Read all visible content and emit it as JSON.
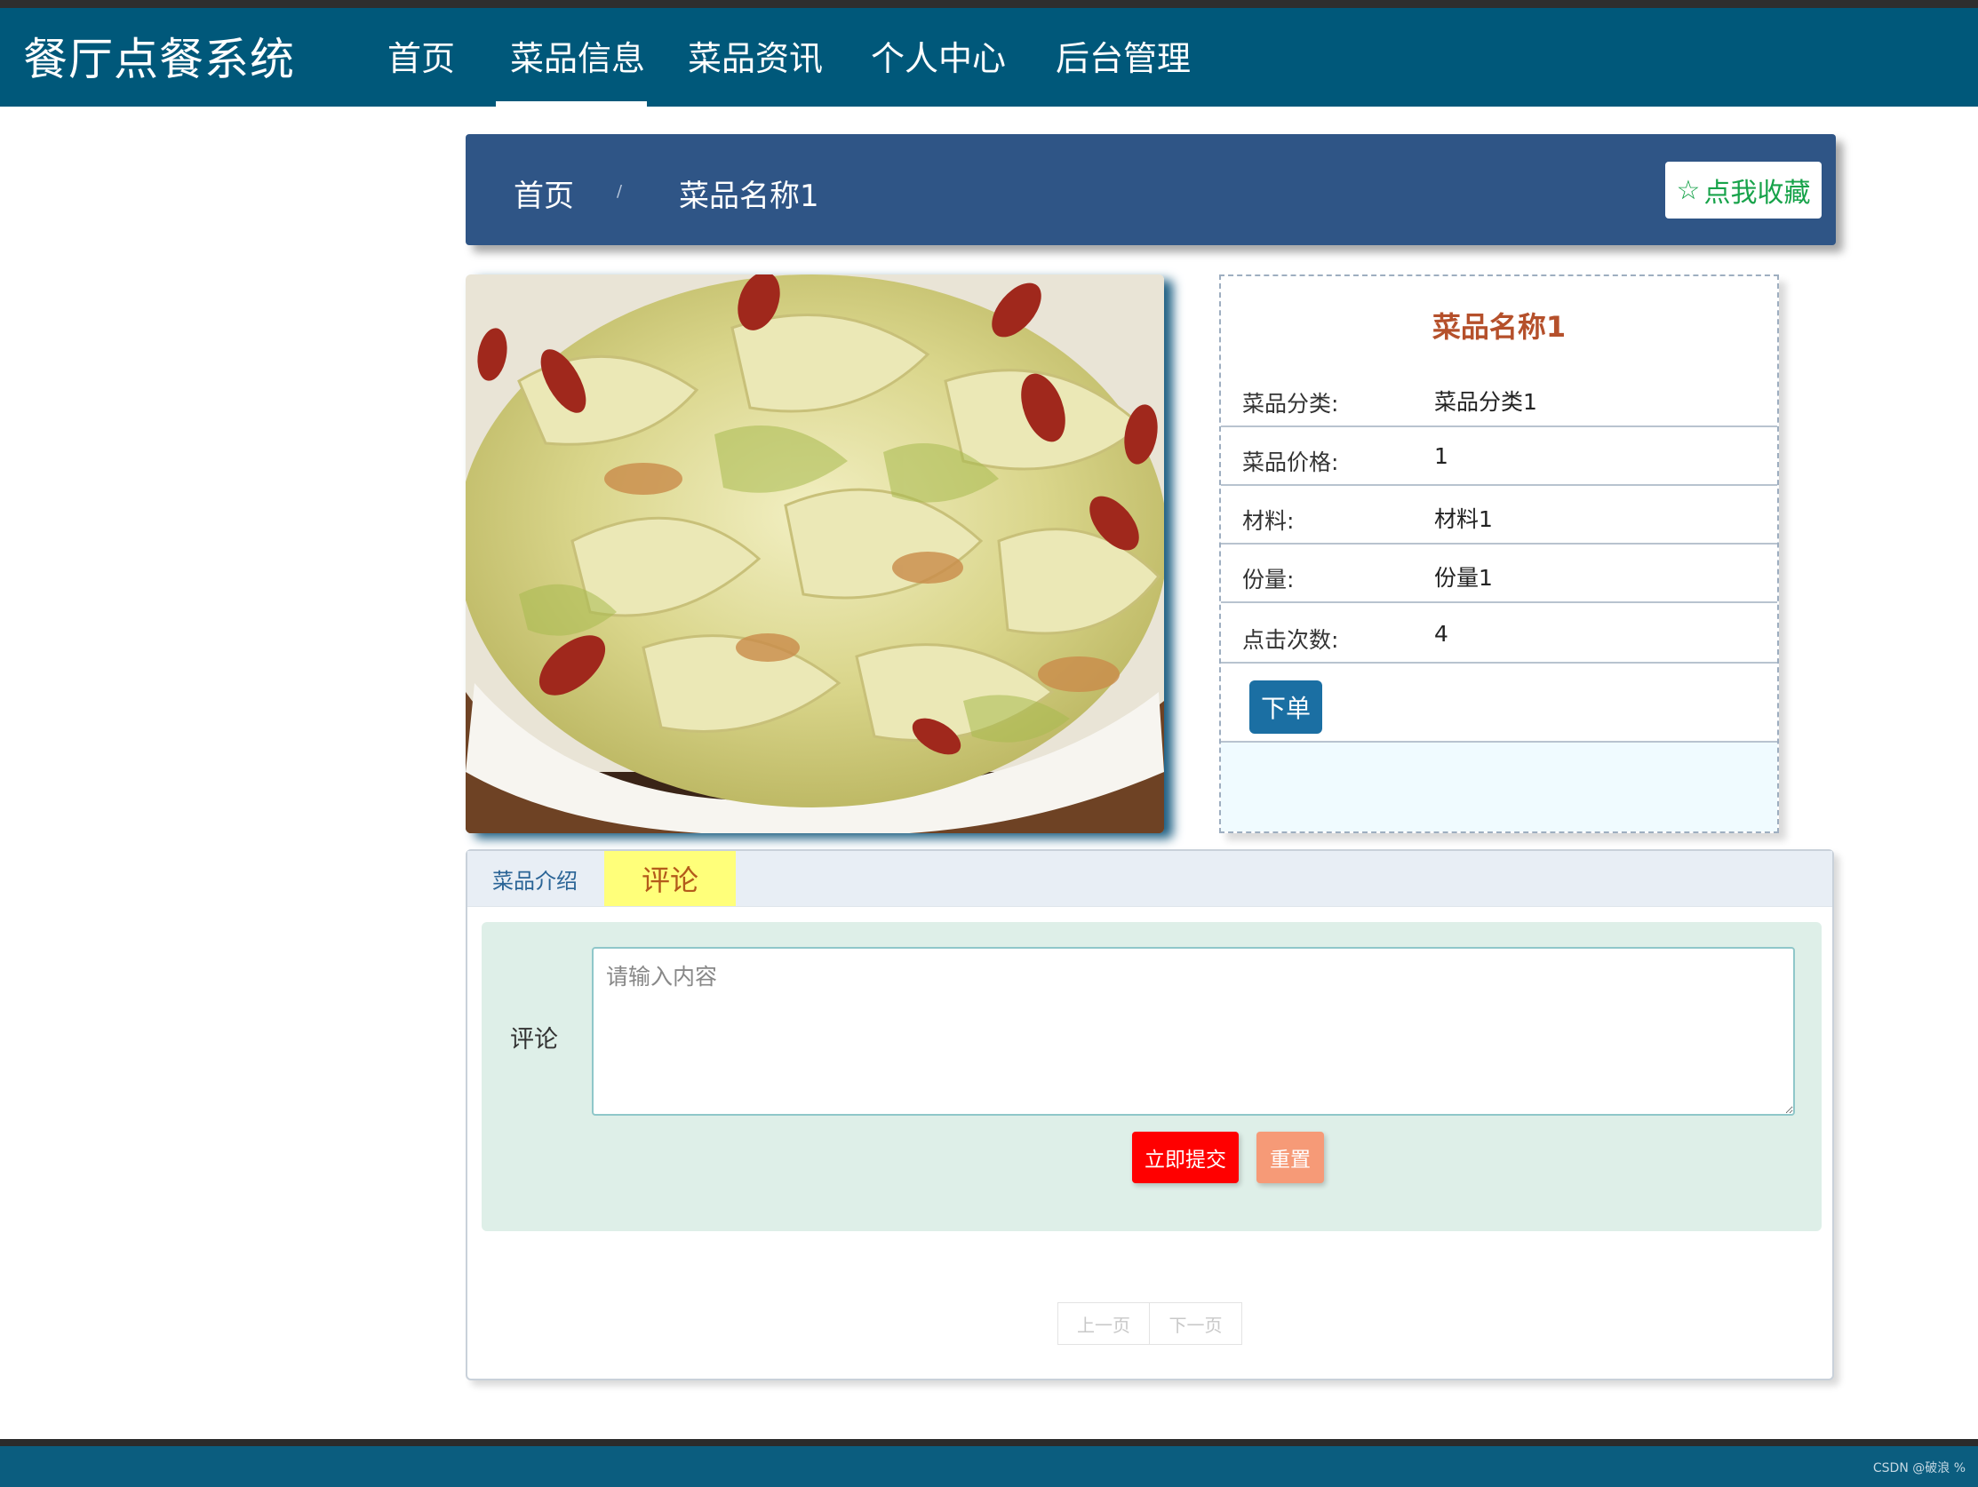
{
  "nav": {
    "title": "餐厅点餐系统",
    "items": [
      {
        "label": "首页"
      },
      {
        "label": "菜品信息"
      },
      {
        "label": "菜品资讯"
      },
      {
        "label": "个人中心"
      },
      {
        "label": "后台管理"
      }
    ],
    "active_item": "菜品信息"
  },
  "breadcrumb": {
    "home": "首页",
    "separator": "/",
    "current": "菜品名称1"
  },
  "favorite": {
    "icon": "star-outline-icon",
    "label": "点我收藏"
  },
  "dish": {
    "image_alt": "dish-photo-stir-fried-cabbage",
    "name": "菜品名称1",
    "fields": [
      {
        "label": "菜品分类:",
        "value": "菜品分类1"
      },
      {
        "label": "菜品价格:",
        "value": "1"
      },
      {
        "label": "材料:",
        "value": "材料1"
      },
      {
        "label": "份量:",
        "value": "份量1"
      },
      {
        "label": "点击次数:",
        "value": "4"
      }
    ],
    "order_label": "下单"
  },
  "tabs": {
    "items": [
      {
        "label": "菜品介绍"
      },
      {
        "label": "评论"
      }
    ],
    "active": "评论"
  },
  "comment_form": {
    "label": "评论",
    "placeholder": "请输入内容",
    "value": "",
    "submit_label": "立即提交",
    "reset_label": "重置"
  },
  "pagination": {
    "prev": "上一页",
    "next": "下一页"
  },
  "footer": {
    "watermark": "CSDN @破浪 %"
  },
  "colors": {
    "navbar": "#00587a",
    "breadcrumb_panel": "#2f5586",
    "favorite_text": "#17a34a",
    "dish_name": "#b5502b",
    "order_button": "#1b6fa3",
    "active_tab_bg": "#ffff7a",
    "submit_button": "#ff0000",
    "reset_button": "#f69a77",
    "form_bg": "#deefe8",
    "footer": "#0b5d7f"
  }
}
